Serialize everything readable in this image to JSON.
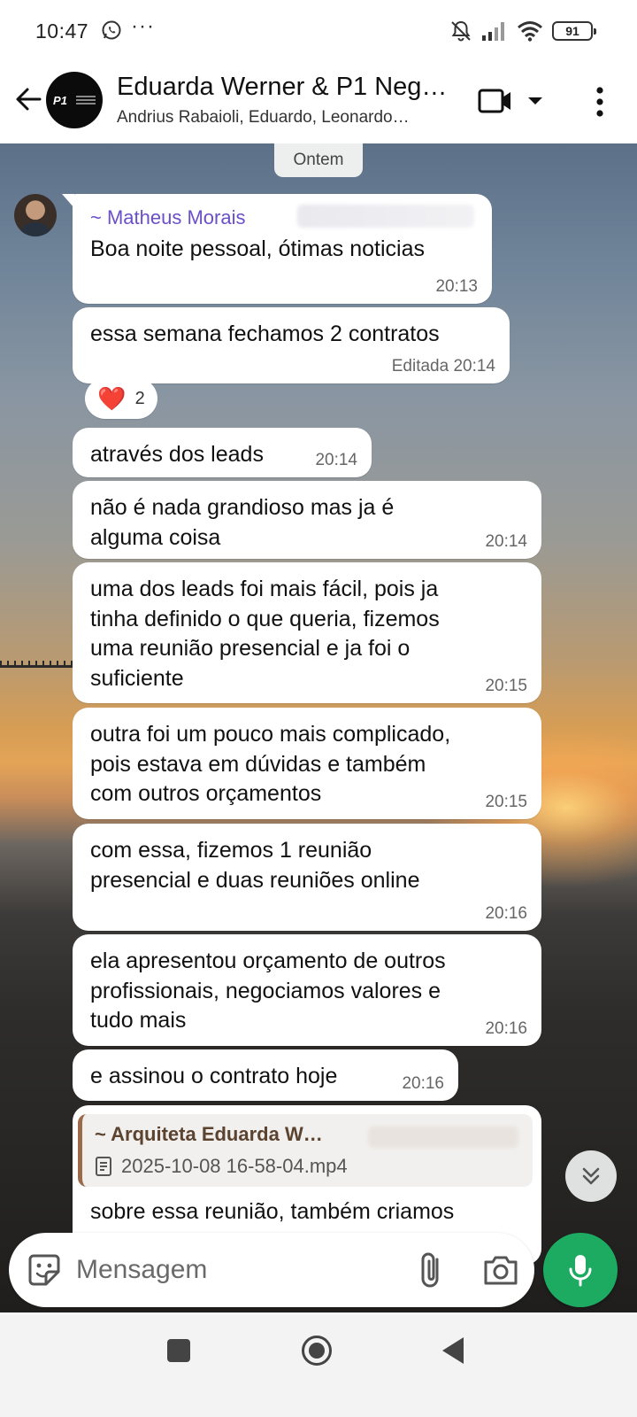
{
  "status_bar": {
    "time": "10:47",
    "battery": "91",
    "icons": [
      "whatsapp-icon",
      "more-dots-icon",
      "bell-off-icon",
      "signal-icon",
      "wifi-icon",
      "battery-icon"
    ]
  },
  "header": {
    "title": "Eduarda Werner & P1 Neg…",
    "members": "Andrius Rabaioli, Eduardo, Leonardo…",
    "avatar_label": "P1"
  },
  "chat": {
    "date_divider": "Ontem",
    "messages": [
      {
        "sender": "~ Matheus Morais",
        "text": "Boa noite pessoal, ótimas noticias",
        "time": "20:13"
      },
      {
        "text": "essa semana fechamos 2 contratos",
        "time": "Editada 20:14",
        "reaction": {
          "emoji": "❤️",
          "count": "2"
        }
      },
      {
        "text": "através dos leads",
        "time": "20:14"
      },
      {
        "text": "não é nada grandioso mas ja é\nalguma coisa",
        "time": "20:14"
      },
      {
        "text": "uma dos leads foi mais fácil, pois ja\ntinha definido o que queria, fizemos\numa reunião presencial e ja foi o\nsuficiente",
        "time": "20:15"
      },
      {
        "text": "outra foi um pouco mais complicado,\npois estava em dúvidas e também\ncom outros orçamentos",
        "time": "20:15"
      },
      {
        "text": "com essa, fizemos 1 reunião\npresencial e duas reuniões online",
        "time": "20:16"
      },
      {
        "text": "ela apresentou orçamento de outros\nprofissionais, negociamos valores e\ntudo mais",
        "time": "20:16"
      },
      {
        "text": "e assinou o contrato hoje",
        "time": "20:16"
      },
      {
        "quote": {
          "author": "~ Arquiteta Eduarda W…",
          "file": "2025-10-08 16-58-04.mp4"
        },
        "text": "sobre essa reunião, também criamos"
      }
    ]
  },
  "input": {
    "placeholder": "Mensagem"
  },
  "colors": {
    "accent_green": "#1daa61",
    "sender_name": "#6b4fc8",
    "quote_border": "#9a6a4a"
  }
}
